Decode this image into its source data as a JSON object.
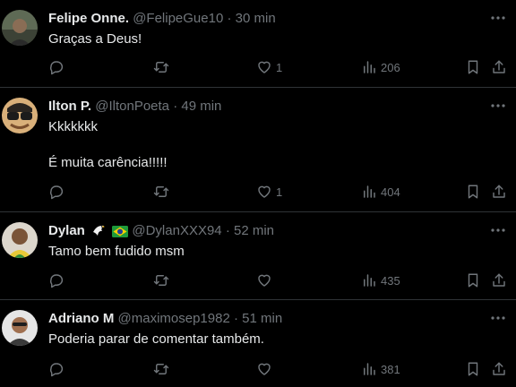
{
  "replies": [
    {
      "name": "Felipe Onne.",
      "handle": "@FelipeGue10",
      "sep": "·",
      "time": "30 min",
      "text": [
        "Graças a Deus!"
      ],
      "likes": "1",
      "views": "206",
      "avatar_color": "#6b6b5e"
    },
    {
      "name": "Ilton P.",
      "handle": "@IltonPoeta",
      "sep": "·",
      "time": "49 min",
      "text": [
        "Kkkkkkk",
        "É muita carência!!!!!"
      ],
      "likes": "1",
      "views": "404",
      "avatar_color": "#c9a070"
    },
    {
      "name": "Dylan",
      "handle": "@DylanXXX94",
      "sep": "·",
      "time": "52 min",
      "text": [
        "Tamo bem fudido msm"
      ],
      "likes": "",
      "views": "435",
      "badges": [
        "eagle-emoji",
        "brazil-flag"
      ],
      "avatar_color": "#d9d2c8"
    },
    {
      "name": "Adriano M",
      "handle": "@maximosep1982",
      "sep": "·",
      "time": "51 min",
      "text": [
        "Poderia parar de comentar também."
      ],
      "likes": "",
      "views": "381",
      "avatar_color": "#e0e0e0"
    }
  ],
  "icons": {
    "reply": "reply-icon",
    "retweet": "retweet-icon",
    "like": "heart-icon",
    "views": "views-icon",
    "bookmark": "bookmark-icon",
    "share": "share-icon",
    "more": "more-icon"
  },
  "colors": {
    "background": "#000000",
    "text": "#e7e9ea",
    "muted": "#71767b",
    "divider": "#2f3336"
  }
}
